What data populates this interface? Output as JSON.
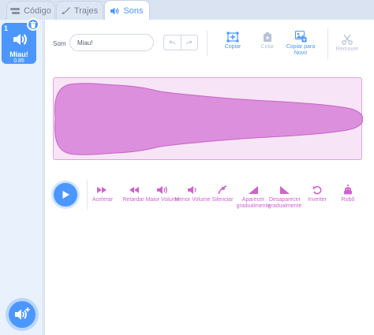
{
  "tabs": [
    {
      "label": "Código",
      "icon": "code-icon"
    },
    {
      "label": "Trajes",
      "icon": "brush-icon"
    },
    {
      "label": "Sons",
      "icon": "speaker-icon"
    }
  ],
  "sound_list": [
    {
      "number": "1",
      "name": "Miau!",
      "duration": "0.85"
    }
  ],
  "editor": {
    "name_label": "Som",
    "name_value": "Miau!",
    "tools": {
      "copy": "Copiar",
      "paste": "Colar",
      "copy_to_new": "Copiar para Novo",
      "delete": "Remover"
    },
    "effects": [
      {
        "label": "Acelerar",
        "icon": "faster-icon"
      },
      {
        "label": "Retardar",
        "icon": "slower-icon"
      },
      {
        "label": "Maior Volume",
        "icon": "louder-icon"
      },
      {
        "label": "Menor Volume",
        "icon": "softer-icon"
      },
      {
        "label": "Silenciar",
        "icon": "mute-icon"
      },
      {
        "label": "Aparecer gradualmente",
        "icon": "fade-in-icon"
      },
      {
        "label": "Desaparecer gradualmente",
        "icon": "fade-out-icon"
      },
      {
        "label": "Inverter",
        "icon": "reverse-icon"
      },
      {
        "label": "Robô",
        "icon": "robot-icon"
      }
    ]
  },
  "colors": {
    "accent": "#4c97ff",
    "sound": "#cf63cf",
    "waveform_fill": "#dc8fdd",
    "waveform_bg": "#f8e4f7"
  }
}
